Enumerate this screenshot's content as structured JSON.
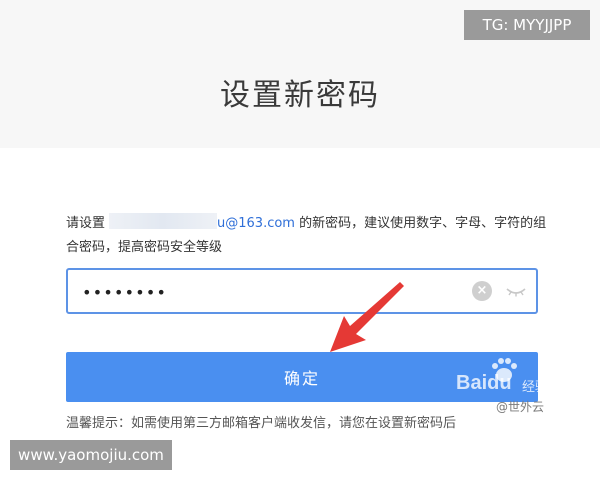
{
  "header": {
    "title": "设置新密码"
  },
  "watermarks": {
    "tg": "TG: MYYJJPP",
    "site": "www.yaomojiu.com",
    "baidu_logo": "Baidu",
    "baidu_jingyan": "经验",
    "attribution": "@世外云"
  },
  "form": {
    "desc_before": "请设置",
    "email_visible": "u@163.com",
    "desc_after": " 的新密码，建议使用数字、字母、字符的组合密码，提高密码安全等级",
    "password_value": "••••••••",
    "confirm_label": "确定",
    "tip": "温馨提示：如需使用第三方邮箱客户端收发信，请您在设置新密码后"
  },
  "colors": {
    "accent": "#4a8ff0",
    "input_border": "#5d93e6",
    "arrow": "#e53935"
  },
  "icons": {
    "clear": "clear-icon",
    "visibility": "eye-icon",
    "pointer": "arrow-icon"
  }
}
